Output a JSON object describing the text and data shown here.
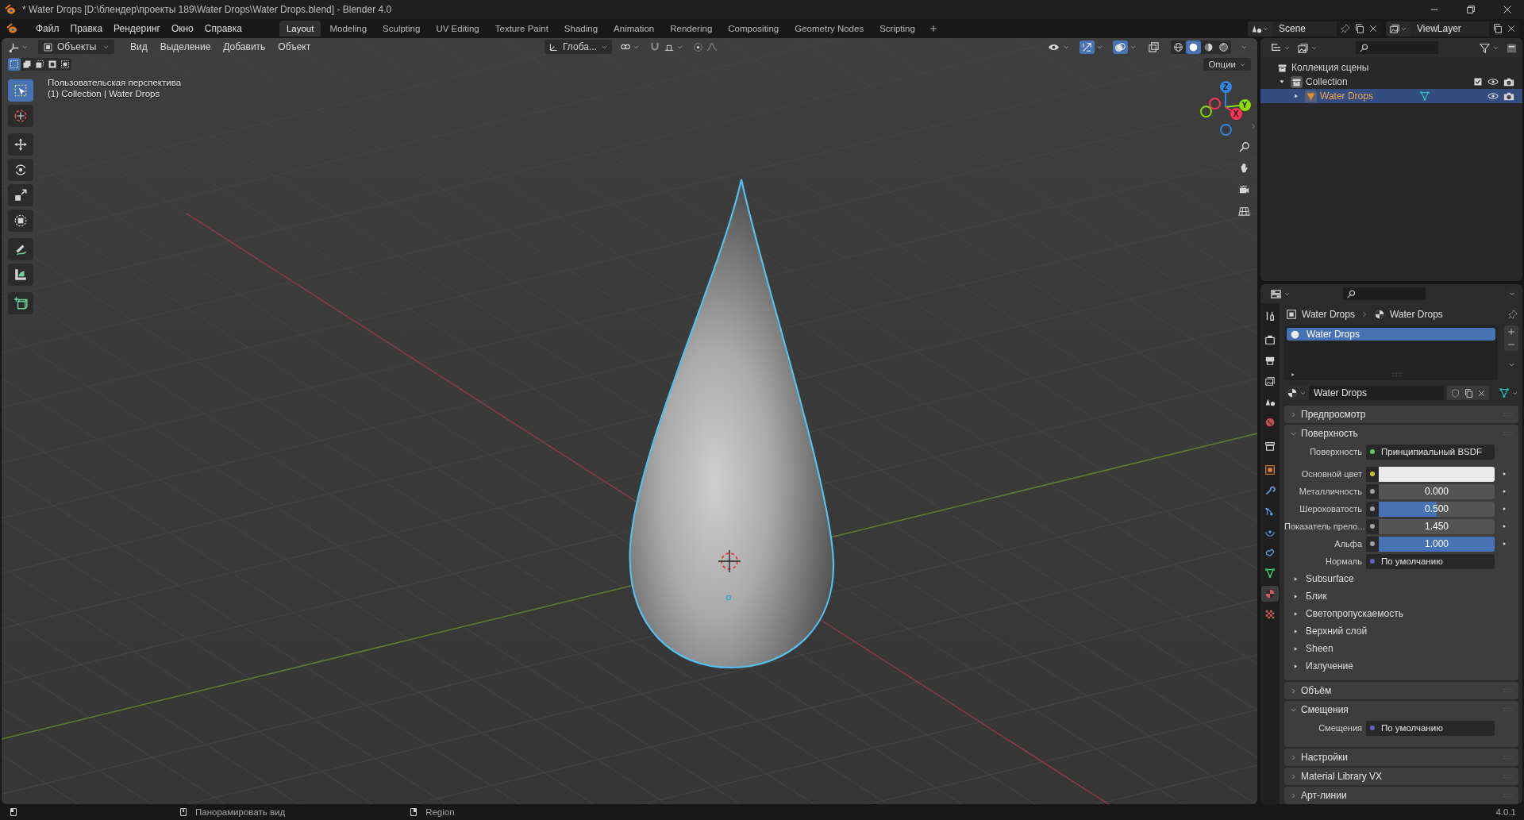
{
  "window": {
    "title": "* Water Drops [D:\\блендер\\проекты 189\\Water Drops\\Water Drops.blend] - Blender 4.0"
  },
  "menu": [
    "Файл",
    "Правка",
    "Рендеринг",
    "Окно",
    "Справка"
  ],
  "workspaces": [
    {
      "label": "Layout",
      "selected": true
    },
    {
      "label": "Modeling",
      "selected": false
    },
    {
      "label": "Sculpting",
      "selected": false
    },
    {
      "label": "UV Editing",
      "selected": false
    },
    {
      "label": "Texture Paint",
      "selected": false
    },
    {
      "label": "Shading",
      "selected": false
    },
    {
      "label": "Animation",
      "selected": false
    },
    {
      "label": "Rendering",
      "selected": false
    },
    {
      "label": "Compositing",
      "selected": false
    },
    {
      "label": "Geometry Nodes",
      "selected": false
    },
    {
      "label": "Scripting",
      "selected": false
    }
  ],
  "scene": {
    "value": "Scene"
  },
  "view_layer": {
    "value": "ViewLayer"
  },
  "viewport": {
    "mode": "Объекты",
    "menus": [
      "Вид",
      "Выделение",
      "Добавить",
      "Объект"
    ],
    "orientation": "Глоба...",
    "snap": {
      "on": false
    },
    "proportional": {
      "on": false
    },
    "toggles": [
      {
        "kind": "visibility",
        "on": false
      },
      {
        "kind": "gizmo",
        "on": true
      },
      {
        "kind": "overlays",
        "on": true
      },
      {
        "kind": "xray",
        "on": false
      }
    ],
    "shading": [
      {
        "kind": "wireframe",
        "selected": false
      },
      {
        "kind": "solid",
        "selected": true
      },
      {
        "kind": "material",
        "selected": false
      },
      {
        "kind": "rendered",
        "selected": false
      }
    ],
    "select_modes": [
      {
        "kind": "set",
        "selected": true
      },
      {
        "kind": "extend",
        "selected": false
      },
      {
        "kind": "subtract",
        "selected": false
      },
      {
        "kind": "invert",
        "selected": false
      },
      {
        "kind": "intersect",
        "selected": false
      }
    ],
    "options": "Опции",
    "overlay_text": [
      "Пользовательская перспектива",
      "(1) Collection | Water Drops"
    ],
    "tool_groups": [
      [
        {
          "kind": "select_box",
          "selected": true
        },
        {
          "kind": "cursor",
          "selected": false
        }
      ],
      [
        {
          "kind": "move",
          "selected": false
        },
        {
          "kind": "rotate",
          "selected": false
        },
        {
          "kind": "scale",
          "selected": false
        },
        {
          "kind": "transform",
          "selected": false
        }
      ],
      [
        {
          "kind": "annotate",
          "selected": false
        },
        {
          "kind": "measure",
          "selected": false
        }
      ],
      [
        {
          "kind": "add_cube",
          "selected": false
        }
      ]
    ],
    "gizmo": {
      "axes": [
        {
          "label": "Z",
          "color": "#2e86de"
        },
        {
          "label": "Y",
          "color": "#8bdc00"
        },
        {
          "label": "X",
          "color": "#ff3352"
        }
      ]
    }
  },
  "outliner": {
    "items": [
      {
        "label": "Коллекция сцены",
        "kind": "scene_collection",
        "children": [
          {
            "label": "Collection",
            "kind": "collection",
            "expanded": true,
            "checked": true,
            "selected": false,
            "children": [
              {
                "label": "Water Drops",
                "kind": "object",
                "expanded": false,
                "selected": true
              }
            ]
          }
        ]
      }
    ]
  },
  "properties": {
    "tabs": [
      {
        "kind": "tool",
        "selected": false
      },
      {
        "kind": "render",
        "selected": false
      },
      {
        "kind": "output",
        "selected": false
      },
      {
        "kind": "view_layer",
        "selected": false
      },
      {
        "kind": "scene",
        "selected": false
      },
      {
        "kind": "world",
        "selected": false
      },
      {
        "kind": "collection",
        "selected": false
      },
      {
        "kind": "object",
        "selected": false
      },
      {
        "kind": "modifiers",
        "selected": false
      },
      {
        "kind": "particles",
        "selected": false
      },
      {
        "kind": "physics",
        "selected": false
      },
      {
        "kind": "constraints",
        "selected": false
      },
      {
        "kind": "data",
        "selected": false
      },
      {
        "kind": "material",
        "selected": true
      },
      {
        "kind": "texture",
        "selected": false
      }
    ],
    "breadcrumb": [
      "Water Drops",
      "Water Drops"
    ],
    "material_slots": [
      {
        "name": "Water Drops",
        "selected": true
      }
    ],
    "material": "Water Drops",
    "panels": [
      {
        "title": "Предпросмотр",
        "expanded": false
      },
      {
        "title": "Поверхность",
        "expanded": true,
        "fields": [
          {
            "label": "Поверхность",
            "kind": "shader",
            "value": "Принципиальный BSDF"
          },
          {
            "label": "Основной цвет",
            "kind": "color",
            "color": "#ebebeb"
          },
          {
            "label": "Металличность",
            "kind": "slider",
            "value": "0.000",
            "level": 0
          },
          {
            "label": "Шероховатость",
            "kind": "slider",
            "value": "0.500",
            "level": 0.5
          },
          {
            "label": "Показатель прело...",
            "kind": "number",
            "value": "1.450"
          },
          {
            "label": "Альфа",
            "kind": "slider",
            "value": "1.000",
            "level": 1
          },
          {
            "label": "Нормаль",
            "kind": "vector",
            "value": "По умолчанию"
          }
        ],
        "subpanels": [
          {
            "title": "Subsurface",
            "expanded": false
          },
          {
            "title": "Блик",
            "expanded": false
          },
          {
            "title": "Светопропускаемость",
            "expanded": false
          },
          {
            "title": "Верхний слой",
            "expanded": false
          },
          {
            "title": "Sheen",
            "expanded": false
          },
          {
            "title": "Излучение",
            "expanded": false
          }
        ]
      },
      {
        "title": "Объём",
        "expanded": false
      },
      {
        "title": "Смещения",
        "expanded": true,
        "fields": [
          {
            "label": "Смещения",
            "kind": "vector",
            "value": "По умолчанию"
          }
        ]
      },
      {
        "title": "Настройки",
        "expanded": false
      },
      {
        "title": "Material Library VX",
        "expanded": false
      },
      {
        "title": "Арт-линии",
        "expanded": false
      }
    ]
  },
  "status_bar": {
    "hints": [
      {
        "kind": "left"
      },
      {
        "kind": "middle",
        "label": "Панорамировать вид"
      },
      {
        "kind": "right",
        "label": "Region"
      }
    ],
    "version": "4.0.1"
  }
}
